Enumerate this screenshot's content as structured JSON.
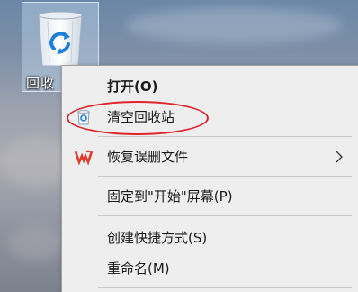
{
  "desktop": {
    "recycle_bin_label": "回收"
  },
  "context_menu": {
    "items": [
      {
        "label": "打开(O)",
        "bold": true
      },
      {
        "label": "清空回收站",
        "icon": "recycle-bin-small-icon"
      },
      {
        "label": "恢复误删文件",
        "icon": "wps-logo-icon",
        "has_submenu": true
      },
      {
        "label": "固定到\"开始\"屏幕(P)"
      },
      {
        "label": "创建快捷方式(S)"
      },
      {
        "label": "重命名(M)"
      }
    ]
  },
  "colors": {
    "annotation_red": "#e0232a",
    "wps_red": "#e23a2b",
    "menu_background": "#eeeeee"
  }
}
